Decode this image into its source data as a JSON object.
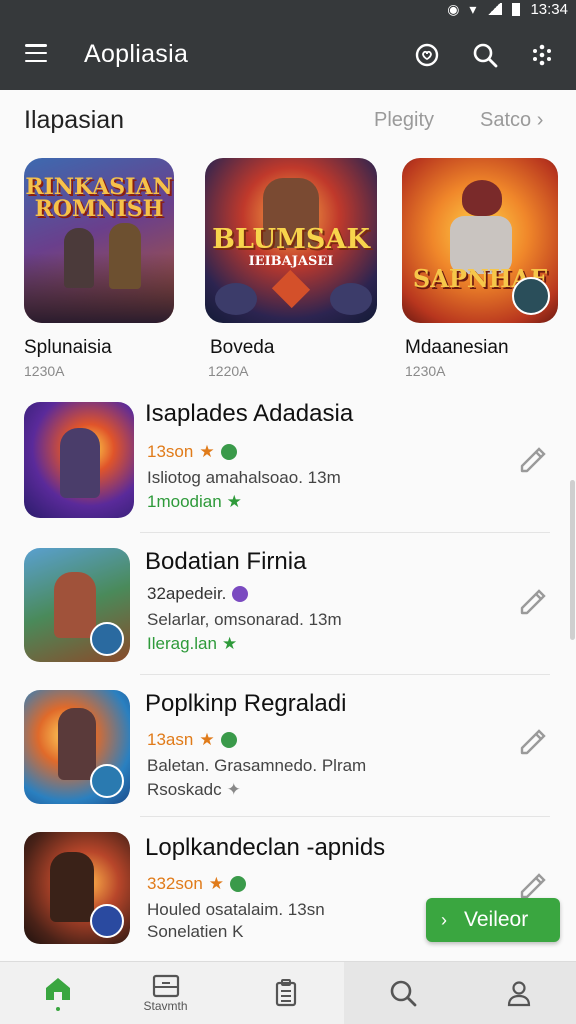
{
  "status_bar": {
    "time": "13:34"
  },
  "app_bar": {
    "title": "Aopliasia"
  },
  "section": {
    "title": "Ilapasian",
    "chip_1": "Plegity",
    "chip_2": "Satco ›"
  },
  "featured": [
    {
      "name": "Splunaisia",
      "sub": "1230A",
      "art_text": "RINKASIAN ROMNISH"
    },
    {
      "name": "Boveda",
      "sub": "1220A",
      "art_text": "BLUMSAK",
      "art_sub": "IEIBAJASEI"
    },
    {
      "name": "Mdaanesian",
      "sub": "1230A",
      "art_text": "SAPNHAF"
    }
  ],
  "list": [
    {
      "title": "Isaplades Adadasia",
      "line1": "13son",
      "line2": "Isliotog amahalsoao. 13m",
      "line3": "1moodian"
    },
    {
      "title": "Bodatian Firnia",
      "line1": "32apedeir.",
      "line2": "Selarlar, omsonarad. 13m",
      "line3": "Ilerag.lan"
    },
    {
      "title": "Poplkinp Regraladi",
      "line1": "13asn",
      "line2": "Baletan. Grasamnedo. Plram",
      "line3": "Rsoskadc"
    },
    {
      "title": "Loplkandeclan -apnids",
      "line1": "332son",
      "line2": "Houled osatalaim. 13sn",
      "line3": "Sonelatien K"
    }
  ],
  "fab": {
    "label": "Veileor"
  },
  "bottom_nav": {
    "tab_2_label": "Stavmth"
  },
  "colors": {
    "appbar": "#36393b",
    "accent_green": "#3aa640",
    "rating_orange": "#e07b1a"
  }
}
